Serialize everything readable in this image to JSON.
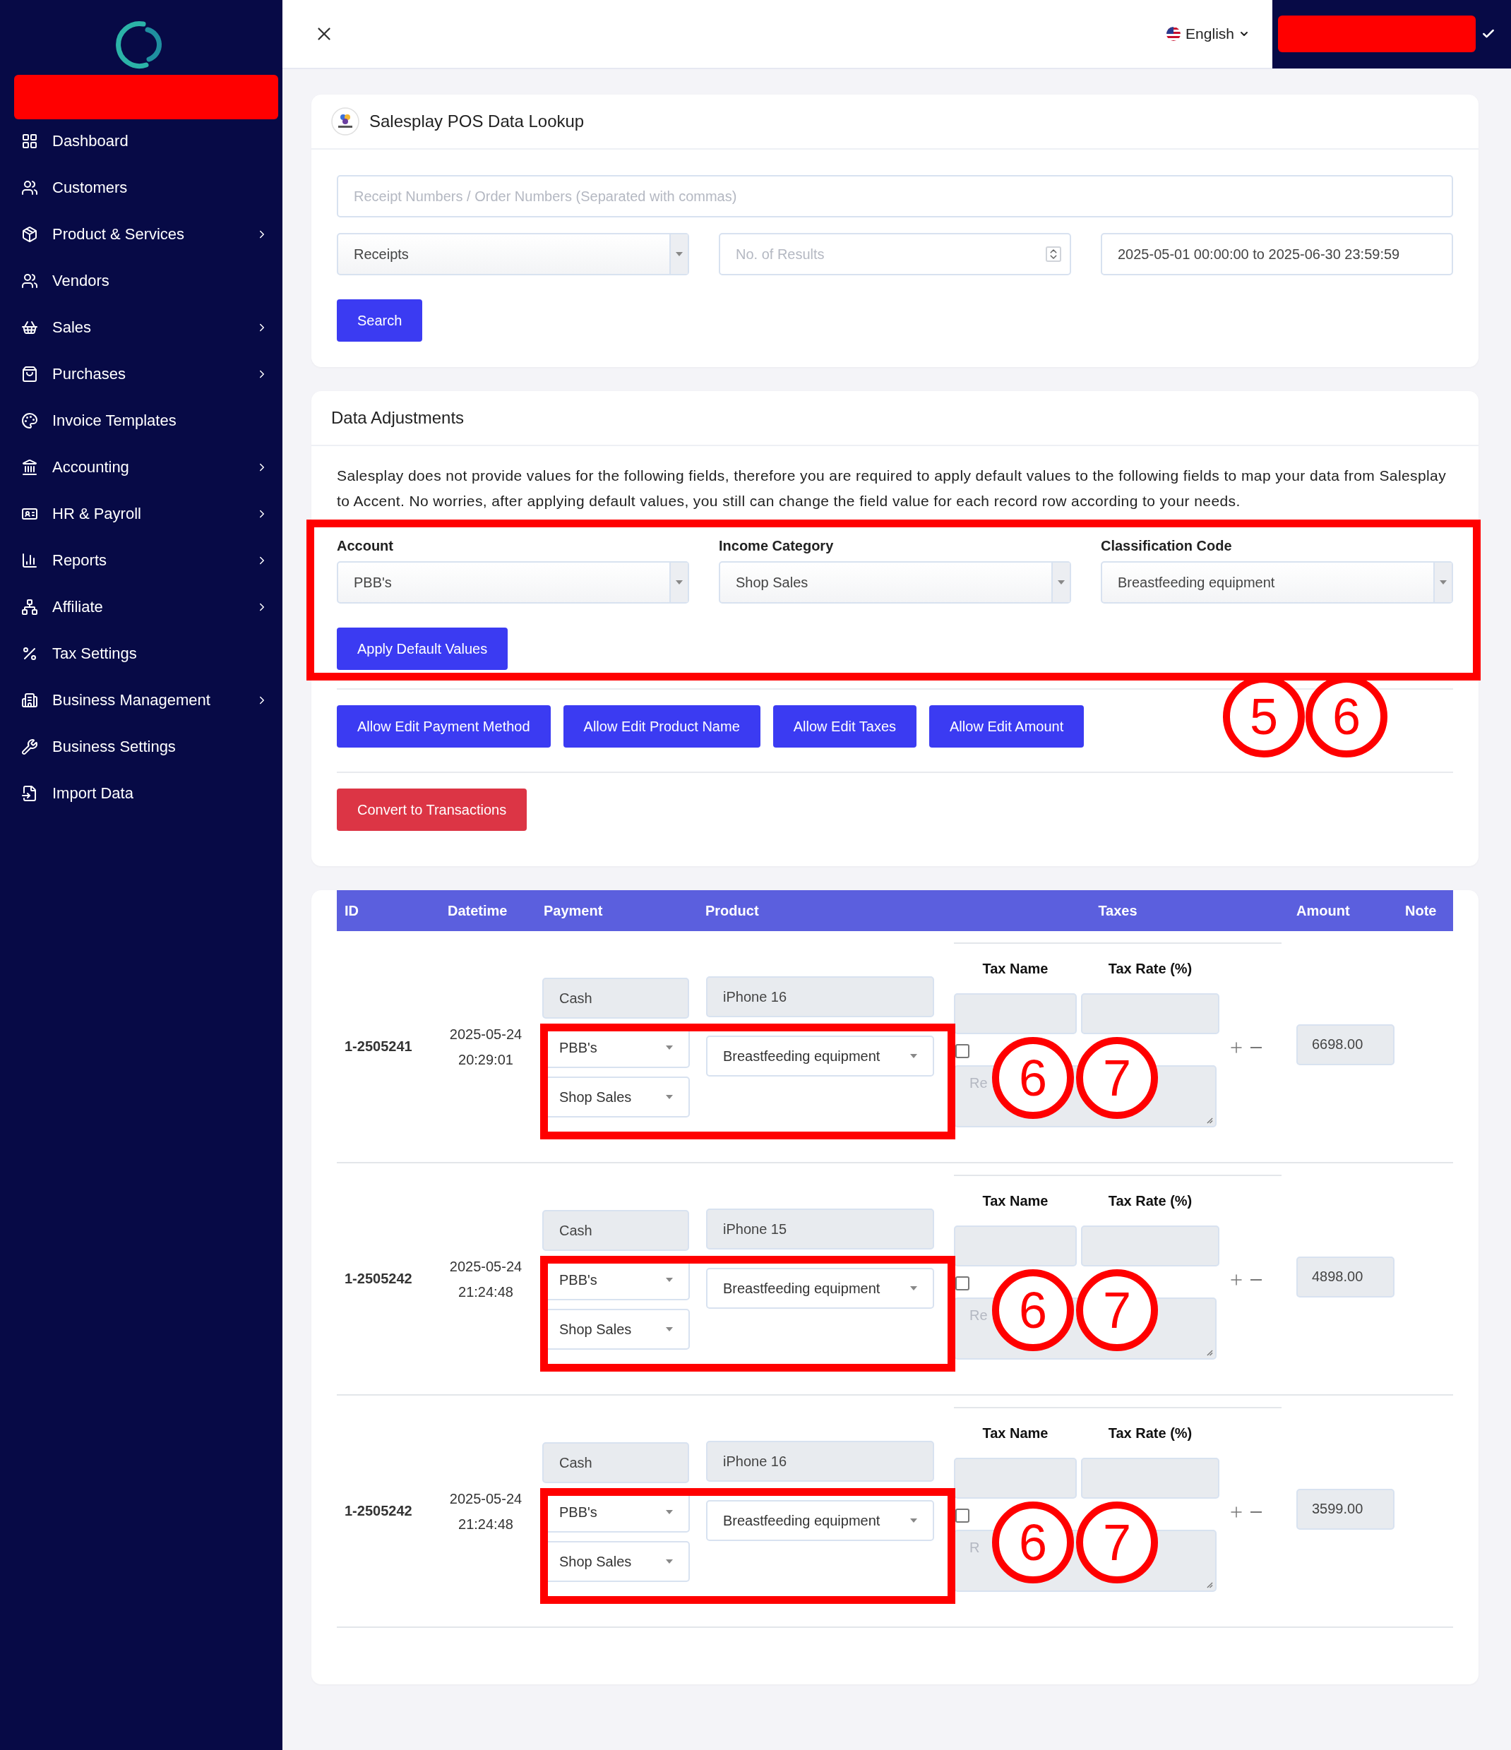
{
  "sidebar": {
    "items": [
      {
        "label": "Dashboard",
        "has_submenu": false
      },
      {
        "label": "Customers",
        "has_submenu": false
      },
      {
        "label": "Product & Services",
        "has_submenu": true
      },
      {
        "label": "Vendors",
        "has_submenu": false
      },
      {
        "label": "Sales",
        "has_submenu": true
      },
      {
        "label": "Purchases",
        "has_submenu": true
      },
      {
        "label": "Invoice Templates",
        "has_submenu": false
      },
      {
        "label": "Accounting",
        "has_submenu": true
      },
      {
        "label": "HR & Payroll",
        "has_submenu": true
      },
      {
        "label": "Reports",
        "has_submenu": true
      },
      {
        "label": "Affiliate",
        "has_submenu": true
      },
      {
        "label": "Tax Settings",
        "has_submenu": false
      },
      {
        "label": "Business Management",
        "has_submenu": true
      },
      {
        "label": "Business Settings",
        "has_submenu": false
      },
      {
        "label": "Import Data",
        "has_submenu": false
      }
    ]
  },
  "topbar": {
    "language": "English"
  },
  "lookup": {
    "title": "Salesplay POS Data Lookup",
    "search_placeholder": "Receipt Numbers / Order Numbers (Separated with commas)",
    "type_select": "Receipts",
    "results_placeholder": "No. of Results",
    "date_range": "2025-05-01 00:00:00 to 2025-06-30 23:59:59",
    "search_button": "Search"
  },
  "adjustments": {
    "title": "Data Adjustments",
    "description": "Salesplay does not provide values for the following fields, therefore you are required to apply default values to the following fields to map your data from Salesplay to Accent. No worries, after applying default values, you still can change the field value for each record row according to your needs.",
    "fields": [
      {
        "label": "Account",
        "value": "PBB's"
      },
      {
        "label": "Income Category",
        "value": "Shop Sales"
      },
      {
        "label": "Classification Code",
        "value": "Breastfeeding equipment"
      }
    ],
    "apply_button": "Apply Default Values",
    "edit_buttons": [
      "Allow Edit Payment Method",
      "Allow Edit Product Name",
      "Allow Edit Taxes",
      "Allow Edit Amount"
    ],
    "convert_button": "Convert to Transactions",
    "annotation_numbers": [
      "5",
      "6"
    ]
  },
  "table": {
    "columns": [
      "ID",
      "Datetime",
      "Payment",
      "Product",
      "Taxes",
      "Amount",
      "Note"
    ],
    "rows": [
      {
        "id": "1-2505241",
        "date": "2025-05-24",
        "time": "20:29:01",
        "payment_method": "Cash",
        "account": "PBB's",
        "income_category": "Shop Sales",
        "product_name": "iPhone 16",
        "classification": "Breastfeeding equipment",
        "tax_name_label": "Tax Name",
        "tax_rate_label": "Tax Rate (%)",
        "checked": false,
        "note_placeholder": "Re",
        "amount": "6698.00",
        "annotation_numbers": [
          "6",
          "7"
        ]
      },
      {
        "id": "1-2505242",
        "date": "2025-05-24",
        "time": "21:24:48",
        "payment_method": "Cash",
        "account": "PBB's",
        "income_category": "Shop Sales",
        "product_name": "iPhone 15",
        "classification": "Breastfeeding equipment",
        "tax_name_label": "Tax Name",
        "tax_rate_label": "Tax Rate (%)",
        "checked": false,
        "note_placeholder": "Re",
        "amount": "4898.00",
        "annotation_numbers": [
          "6",
          "7"
        ]
      },
      {
        "id": "1-2505242",
        "date": "2025-05-24",
        "time": "21:24:48",
        "payment_method": "Cash",
        "account": "PBB's",
        "income_category": "Shop Sales",
        "product_name": "iPhone 16",
        "classification": "Breastfeeding equipment",
        "tax_name_label": "Tax Name",
        "tax_rate_label": "Tax Rate (%)",
        "checked": false,
        "note_placeholder": "R",
        "amount": "3599.00",
        "annotation_numbers": [
          "6",
          "7"
        ]
      }
    ]
  }
}
